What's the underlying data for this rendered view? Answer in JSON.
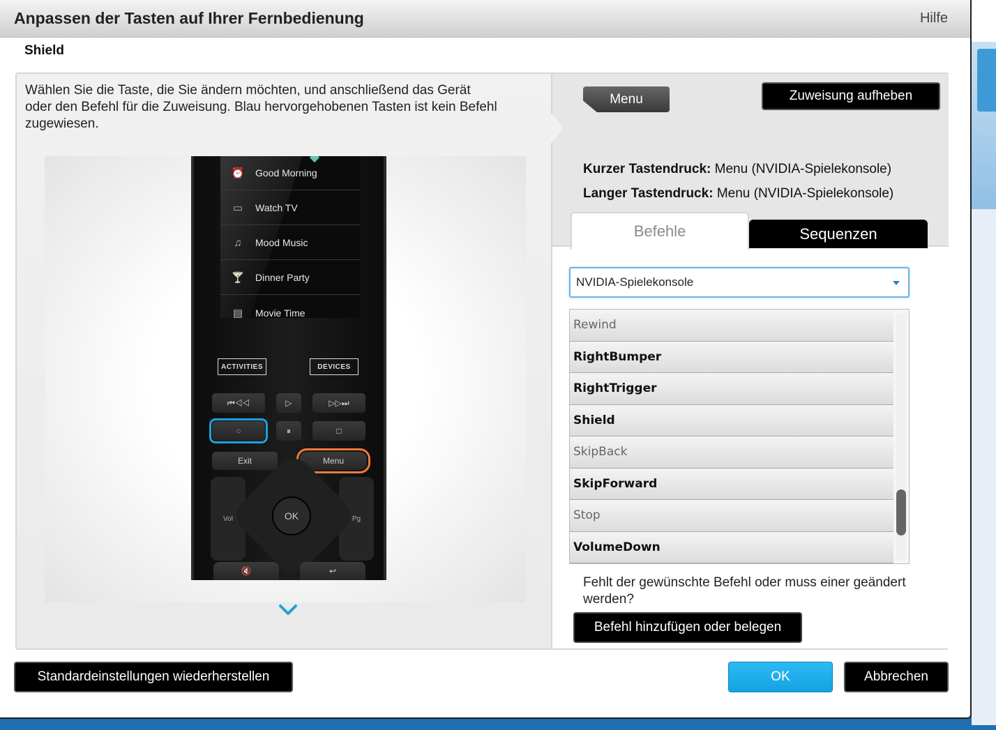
{
  "dialog": {
    "title": "Anpassen der Tasten auf Ihrer Fernbedienung",
    "help": "Hilfe",
    "device_name": "Shield"
  },
  "left": {
    "instructions": "Wählen Sie die Taste, die Sie ändern möchten, und anschließend das Gerät oder den Befehl für die Zuweisung. Blau hervorgehobenen Tasten ist kein Befehl zugewiesen.",
    "remote": {
      "activities": [
        "Good Morning",
        "Watch TV",
        "Mood Music",
        "Dinner Party",
        "Movie Time"
      ],
      "activities_button": "ACTIVITIES",
      "devices_button": "DEVICES",
      "key_exit": "Exit",
      "key_menu": "Menu",
      "key_ok": "OK",
      "key_vol": "Vol",
      "key_pg": "Pg"
    }
  },
  "right": {
    "selected_key": "Menu",
    "unassign_button": "Zuweisung aufheben",
    "short_press_label": "Kurzer Tastendruck:",
    "short_press_value": "Menu (NVIDIA-Spielekonsole)",
    "long_press_label": "Langer Tastendruck:",
    "long_press_value": "Menu (NVIDIA-Spielekonsole)",
    "tabs": [
      "Befehle",
      "Sequenzen"
    ],
    "device_select": "NVIDIA-Spielekonsole",
    "commands": [
      {
        "label": "Rewind",
        "assigned": false
      },
      {
        "label": "RightBumper",
        "assigned": true
      },
      {
        "label": "RightTrigger",
        "assigned": true
      },
      {
        "label": "Shield",
        "assigned": true
      },
      {
        "label": "SkipBack",
        "assigned": false
      },
      {
        "label": "SkipForward",
        "assigned": true
      },
      {
        "label": "Stop",
        "assigned": false
      },
      {
        "label": "VolumeDown",
        "assigned": true
      }
    ],
    "missing_text": "Fehlt der gewünschte Befehl oder muss einer geändert werden?",
    "add_command_button": "Befehl hinzufügen oder belegen"
  },
  "footer": {
    "restore_button": "Standardeinstellungen wiederherstellen",
    "ok_button": "OK",
    "cancel_button": "Abbrechen"
  },
  "colors": {
    "accent_blue": "#19a4df",
    "highlight_orange": "#f07a3a",
    "ok_button": "#1fb0ee"
  }
}
